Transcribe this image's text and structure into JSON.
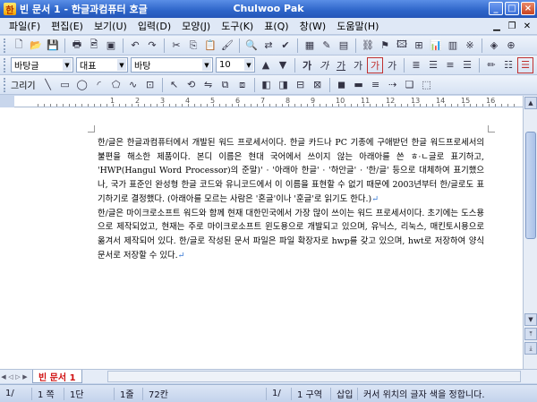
{
  "window": {
    "title": "빈 문서 1 - 한글과컴퓨터 호글",
    "center_title": "Chulwoo Pak",
    "min_label": "_",
    "max_label": "□",
    "close_label": "×"
  },
  "menu": {
    "items": [
      "파일(F)",
      "편집(E)",
      "보기(U)",
      "입력(D)",
      "모양(J)",
      "도구(K)",
      "표(Q)",
      "창(W)",
      "도움말(H)"
    ]
  },
  "toolbar2": {
    "language_combo": "바탕글",
    "style_combo": "대표",
    "font_combo": "바탕",
    "size_combo": "10",
    "format_glyphs": [
      "가",
      "가",
      "가",
      "가",
      "가",
      "가"
    ]
  },
  "toolbar3": {
    "draw_label": "그리기"
  },
  "ruler": {
    "numbers": [
      "1",
      "2",
      "3",
      "4",
      "5",
      "6",
      "7",
      "8",
      "9",
      "10",
      "11",
      "12",
      "13",
      "14",
      "15",
      "16"
    ]
  },
  "document": {
    "paragraphs": [
      "한/글은 한글과컴퓨터에서 개발된 워드 프로세서이다. 한글 카드나 PC 기종에 구애받던 한글 워드프로세서의 불편을 해소한 제품이다. 본디 이름은 현대 국어에서 쓰이지 않는 아래아를 쓴 ㅎ·ㄴ글로 표기하고, 'HWP(Hangul Word Processor)의 준말)' · '아래아 한글' · '하안글' · '한/글' 등으로 대체하여 표기했으나, 국가 표준인 완성형 한글 코드와 유니코드에서 이 이름을 표현할 수 없기 때문에 2003년부터 한/글로도 표기하기로 결정했다. (아래아를 모르는 사람은 '혼글'이나 '훈글'로 읽기도 한다.)",
      "한/글은 마이크로소프트 워드와 함께 현재 대한민국에서 가장 많이 쓰이는 워드 프로세서이다. 초기에는 도스용으로 제작되었고, 현재는 주로 마이크로소프트 윈도용으로 개발되고 있으며, 유닉스, 리눅스, 매킨토시용으로 옮겨서 제작되어 있다. 한/글로 작성된 문서 파일은 파일 확장자로 hwp를 갖고 있으며, hwt로 저장하여 양식 문서로 저장할 수 있다."
    ],
    "para_mark": "↵"
  },
  "tabs": {
    "active_tab": "빈 문서 1"
  },
  "status": {
    "page": "1/",
    "page2": "1/",
    "section": "1 쪽",
    "column": "1단",
    "line": "1줄",
    "char": "72칸",
    "region": "1/",
    "block": "1 구역",
    "mode": "삽입",
    "message": "커서 위치의 글자 색을 정합니다."
  },
  "colors": {
    "title_bar": "#2d64c8",
    "active_tab_text": "#d01010",
    "para_mark": "#3a7bd5"
  }
}
